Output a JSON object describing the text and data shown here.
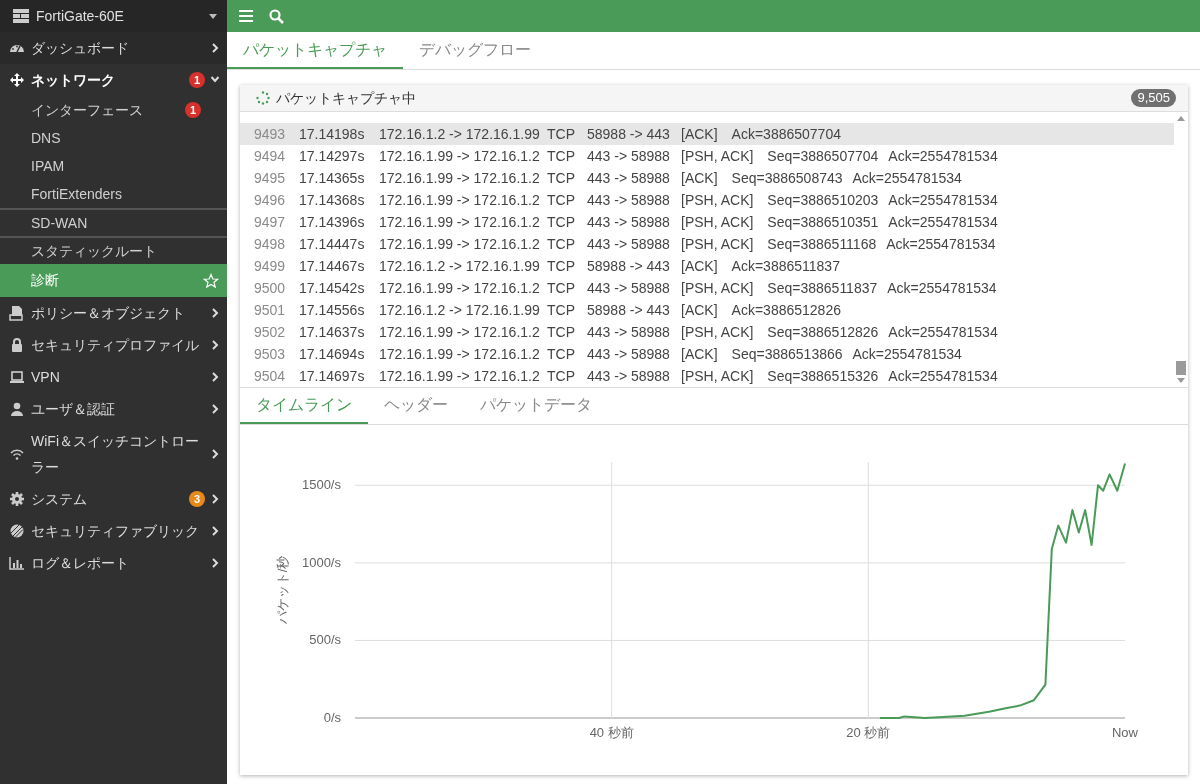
{
  "sidebar": {
    "device": "FortiGate-60E",
    "items": [
      {
        "label": "ダッシュボード",
        "expanded": false
      },
      {
        "label": "ネットワーク",
        "expanded": true,
        "badge": {
          "text": "1",
          "color": "#d8302c"
        },
        "children": [
          {
            "label": "インターフェース",
            "selected": false,
            "badge": {
              "text": "1",
              "color": "#d8302c"
            }
          },
          {
            "label": "DNS",
            "selected": false
          },
          {
            "label": "IPAM",
            "selected": false
          },
          {
            "label": "FortiExtenders",
            "selected": false
          },
          {
            "label": "SD-WAN",
            "selected": false,
            "divider_above": true
          },
          {
            "label": "スタティックルート",
            "selected": false,
            "divider_above": true
          },
          {
            "label": "診断",
            "selected": true
          }
        ]
      },
      {
        "label": "ポリシー＆オブジェクト",
        "expanded": false
      },
      {
        "label": "セキュリティプロファイル",
        "expanded": false
      },
      {
        "label": "VPN",
        "expanded": false
      },
      {
        "label": "ユーザ＆認証",
        "expanded": false
      },
      {
        "label": "WiFi＆スイッチコントローラー",
        "expanded": false
      },
      {
        "label": "システム",
        "expanded": false,
        "badge": {
          "text": "3",
          "color": "#e8891c"
        }
      },
      {
        "label": "セキュリティファブリック",
        "expanded": false
      },
      {
        "label": "ログ＆レポート",
        "expanded": false
      }
    ]
  },
  "tabs": [
    {
      "label": "パケットキャプチャ",
      "selected": true
    },
    {
      "label": "デバッグフロー",
      "selected": false
    }
  ],
  "packet_list": {
    "title": "パケットキャプチャ中",
    "count": "9,505",
    "rows": [
      {
        "no": "9493",
        "time": "17.14198s",
        "flow": "172.16.1.2 -> 172.16.1.99",
        "protocol": "TCP",
        "ports": "58988 -> 443",
        "flags": "[ACK]",
        "info": [
          "Ack=3886507704"
        ],
        "selected": true
      },
      {
        "no": "9494",
        "time": "17.14297s",
        "flow": "172.16.1.99 -> 172.16.1.2",
        "protocol": "TCP",
        "ports": "443 -> 58988",
        "flags": "[PSH, ACK]",
        "info": [
          "Seq=3886507704",
          "Ack=2554781534"
        ],
        "selected": false
      },
      {
        "no": "9495",
        "time": "17.14365s",
        "flow": "172.16.1.99 -> 172.16.1.2",
        "protocol": "TCP",
        "ports": "443 -> 58988",
        "flags": "[ACK]",
        "info": [
          "Seq=3886508743",
          "Ack=2554781534"
        ],
        "selected": false
      },
      {
        "no": "9496",
        "time": "17.14368s",
        "flow": "172.16.1.99 -> 172.16.1.2",
        "protocol": "TCP",
        "ports": "443 -> 58988",
        "flags": "[PSH, ACK]",
        "info": [
          "Seq=3886510203",
          "Ack=2554781534"
        ],
        "selected": false
      },
      {
        "no": "9497",
        "time": "17.14396s",
        "flow": "172.16.1.99 -> 172.16.1.2",
        "protocol": "TCP",
        "ports": "443 -> 58988",
        "flags": "[PSH, ACK]",
        "info": [
          "Seq=3886510351",
          "Ack=2554781534"
        ],
        "selected": false
      },
      {
        "no": "9498",
        "time": "17.14447s",
        "flow": "172.16.1.99 -> 172.16.1.2",
        "protocol": "TCP",
        "ports": "443 -> 58988",
        "flags": "[PSH, ACK]",
        "info": [
          "Seq=3886511168",
          "Ack=2554781534"
        ],
        "selected": false
      },
      {
        "no": "9499",
        "time": "17.14467s",
        "flow": "172.16.1.2 -> 172.16.1.99",
        "protocol": "TCP",
        "ports": "58988 -> 443",
        "flags": "[ACK]",
        "info": [
          "Ack=3886511837"
        ],
        "selected": false
      },
      {
        "no": "9500",
        "time": "17.14542s",
        "flow": "172.16.1.99 -> 172.16.1.2",
        "protocol": "TCP",
        "ports": "443 -> 58988",
        "flags": "[PSH, ACK]",
        "info": [
          "Seq=3886511837",
          "Ack=2554781534"
        ],
        "selected": false
      },
      {
        "no": "9501",
        "time": "17.14556s",
        "flow": "172.16.1.2 -> 172.16.1.99",
        "protocol": "TCP",
        "ports": "58988 -> 443",
        "flags": "[ACK]",
        "info": [
          "Ack=3886512826"
        ],
        "selected": false
      },
      {
        "no": "9502",
        "time": "17.14637s",
        "flow": "172.16.1.99 -> 172.16.1.2",
        "protocol": "TCP",
        "ports": "443 -> 58988",
        "flags": "[PSH, ACK]",
        "info": [
          "Seq=3886512826",
          "Ack=2554781534"
        ],
        "selected": false
      },
      {
        "no": "9503",
        "time": "17.14694s",
        "flow": "172.16.1.99 -> 172.16.1.2",
        "protocol": "TCP",
        "ports": "443 -> 58988",
        "flags": "[ACK]",
        "info": [
          "Seq=3886513866",
          "Ack=2554781534"
        ],
        "selected": false
      },
      {
        "no": "9504",
        "time": "17.14697s",
        "flow": "172.16.1.99 -> 172.16.1.2",
        "protocol": "TCP",
        "ports": "443 -> 58988",
        "flags": "[PSH, ACK]",
        "info": [
          "Seq=3886515326",
          "Ack=2554781534"
        ],
        "selected": false
      }
    ]
  },
  "detail_tabs": [
    {
      "label": "タイムライン",
      "selected": true
    },
    {
      "label": "ヘッダー",
      "selected": false
    },
    {
      "label": "パケットデータ",
      "selected": false
    }
  ],
  "timeline": {
    "chart_data": {
      "type": "line",
      "ylabel": "パケット/秒",
      "x": [
        -19.1,
        -17.6,
        -17.2,
        -15.6,
        -14.5,
        -12.5,
        -10.6,
        -9.2,
        -8.2,
        -7.1,
        -6.2,
        -5.7,
        -5.2,
        -4.6,
        -4.1,
        -3.6,
        -3.1,
        -2.6,
        -2.1,
        -1.7,
        -1.2,
        -0.6,
        0
      ],
      "grid": true,
      "series": [
        {
          "color": "#4a9a58",
          "values": [
            0,
            0,
            10,
            0,
            5,
            15,
            40,
            65,
            80,
            115,
            215,
            1090,
            1240,
            1130,
            1340,
            1195,
            1340,
            1115,
            1500,
            1465,
            1570,
            1465,
            1640
          ]
        }
      ],
      "xlim": [
        -60,
        0
      ],
      "ylim": [
        0,
        1650
      ],
      "xticks": [
        {
          "value": -40,
          "label": "40 秒前"
        },
        {
          "value": -20,
          "label": "20 秒前"
        },
        {
          "value": 0,
          "label": "Now"
        }
      ],
      "yticks": [
        {
          "value": 0,
          "label": "0/s"
        },
        {
          "value": 500,
          "label": "500/s"
        },
        {
          "value": 1000,
          "label": "1000/s"
        },
        {
          "value": 1500,
          "label": "1500/s"
        }
      ]
    }
  }
}
